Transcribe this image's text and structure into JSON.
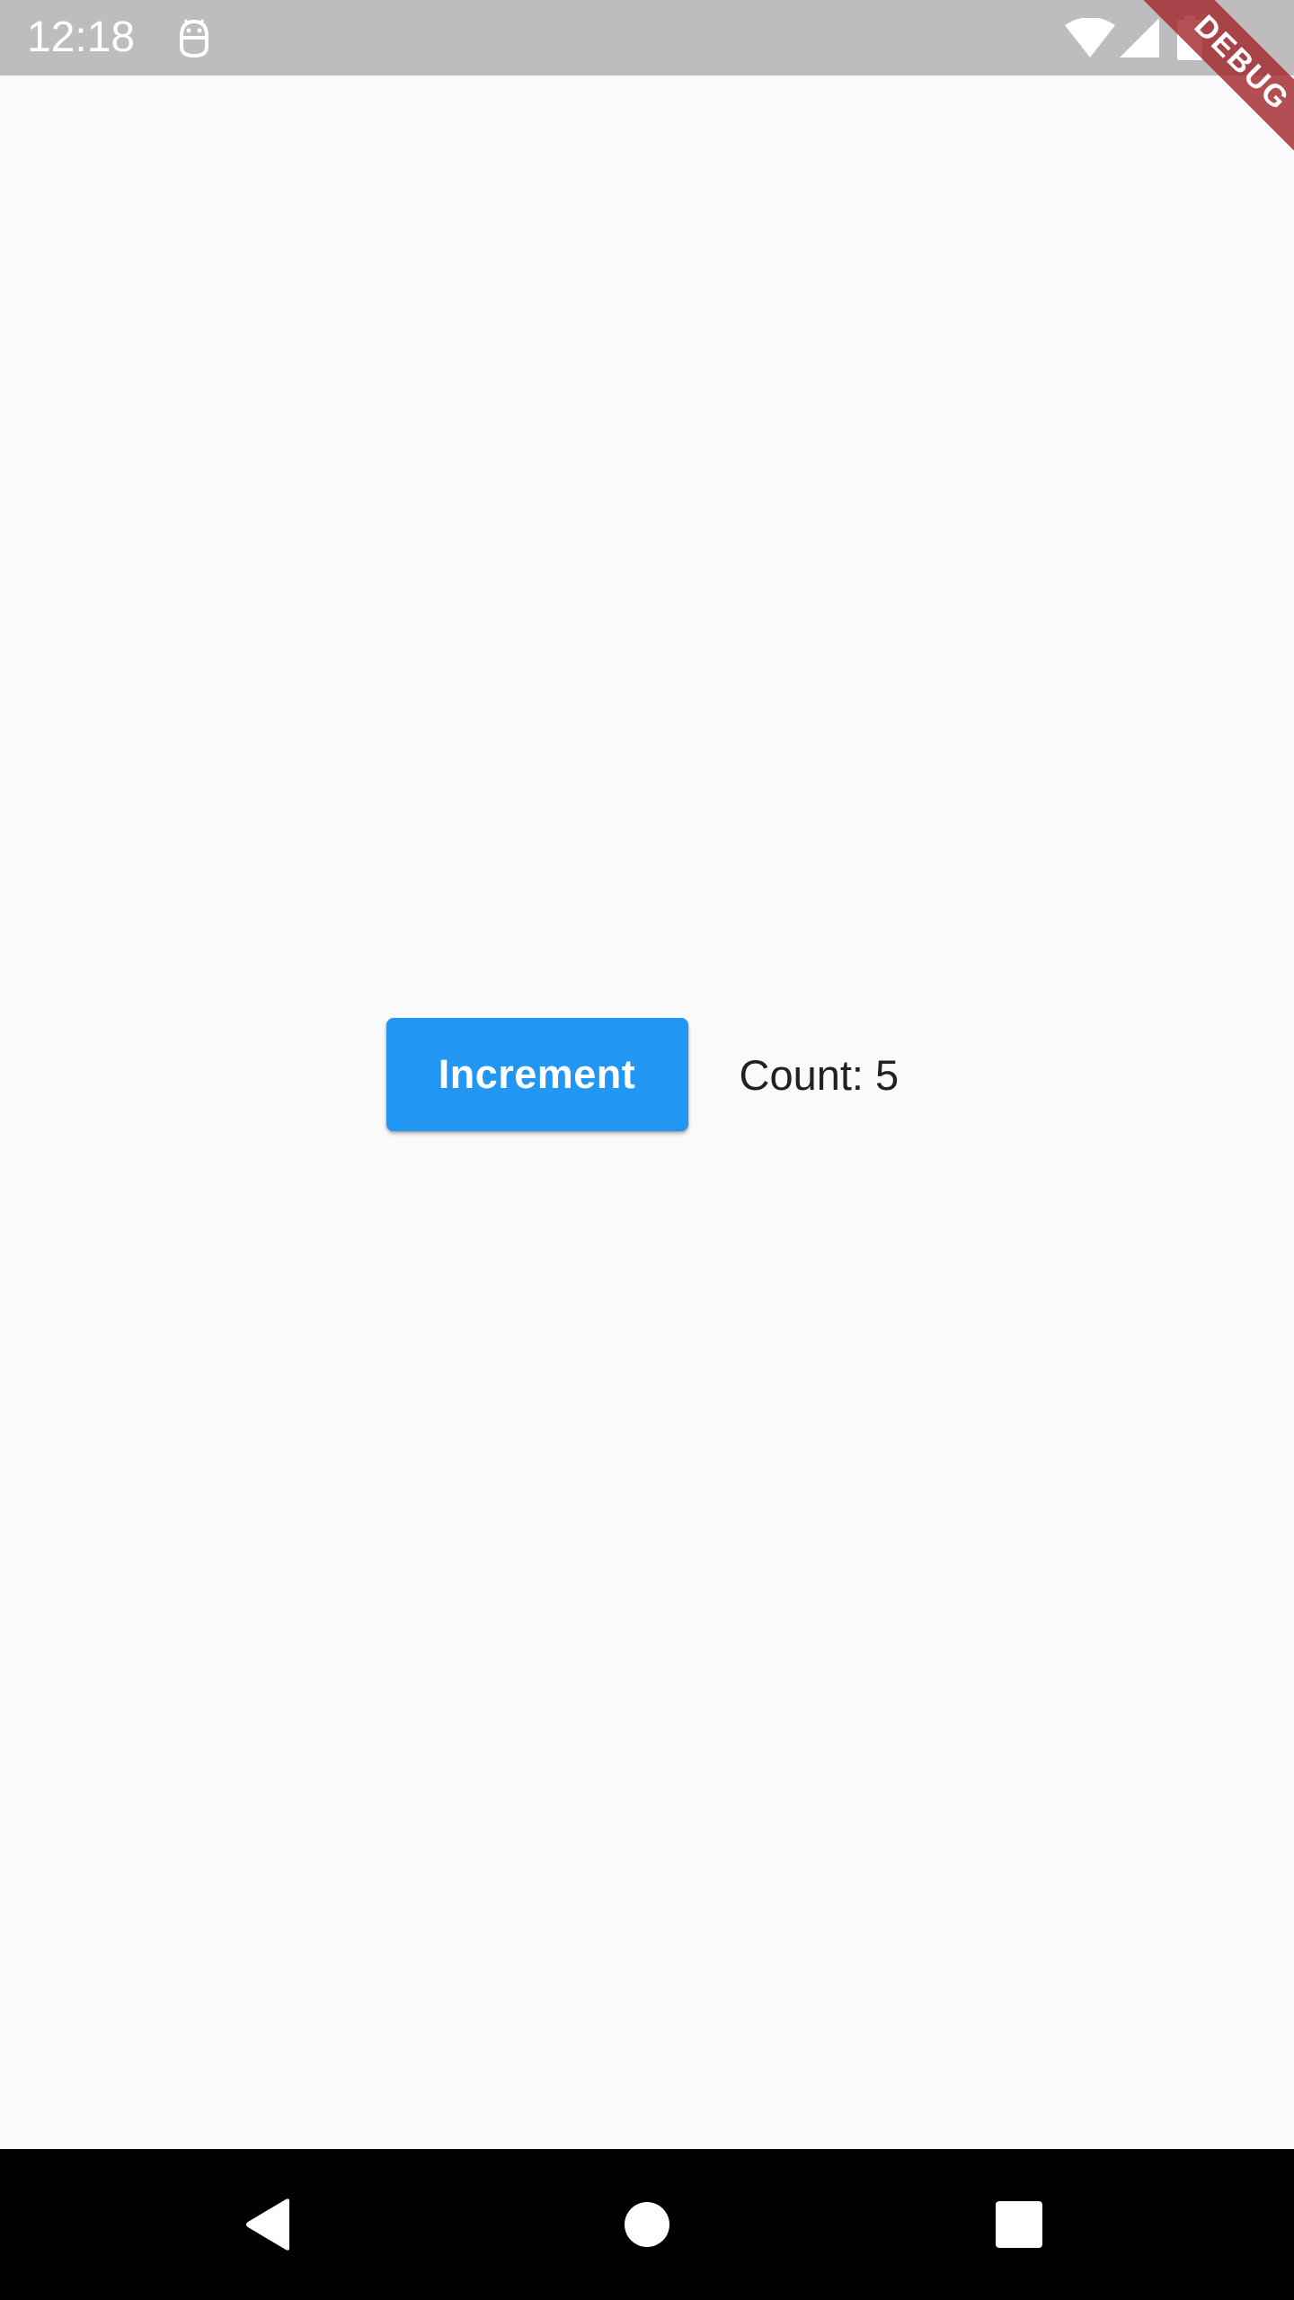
{
  "status_bar": {
    "time": "12:18",
    "background_color": "#bdbdbd",
    "icons": [
      "android-debug-icon",
      "wifi-icon",
      "cellular-signal-icon",
      "battery-icon"
    ]
  },
  "debug_banner": {
    "label": "DEBUG",
    "color": "#a32830"
  },
  "main": {
    "increment_button_label": "Increment",
    "count_text": "Count: 5",
    "accent_color": "#2196f3"
  },
  "nav_bar": {
    "icons": [
      "back-icon",
      "home-icon",
      "recents-icon"
    ]
  }
}
